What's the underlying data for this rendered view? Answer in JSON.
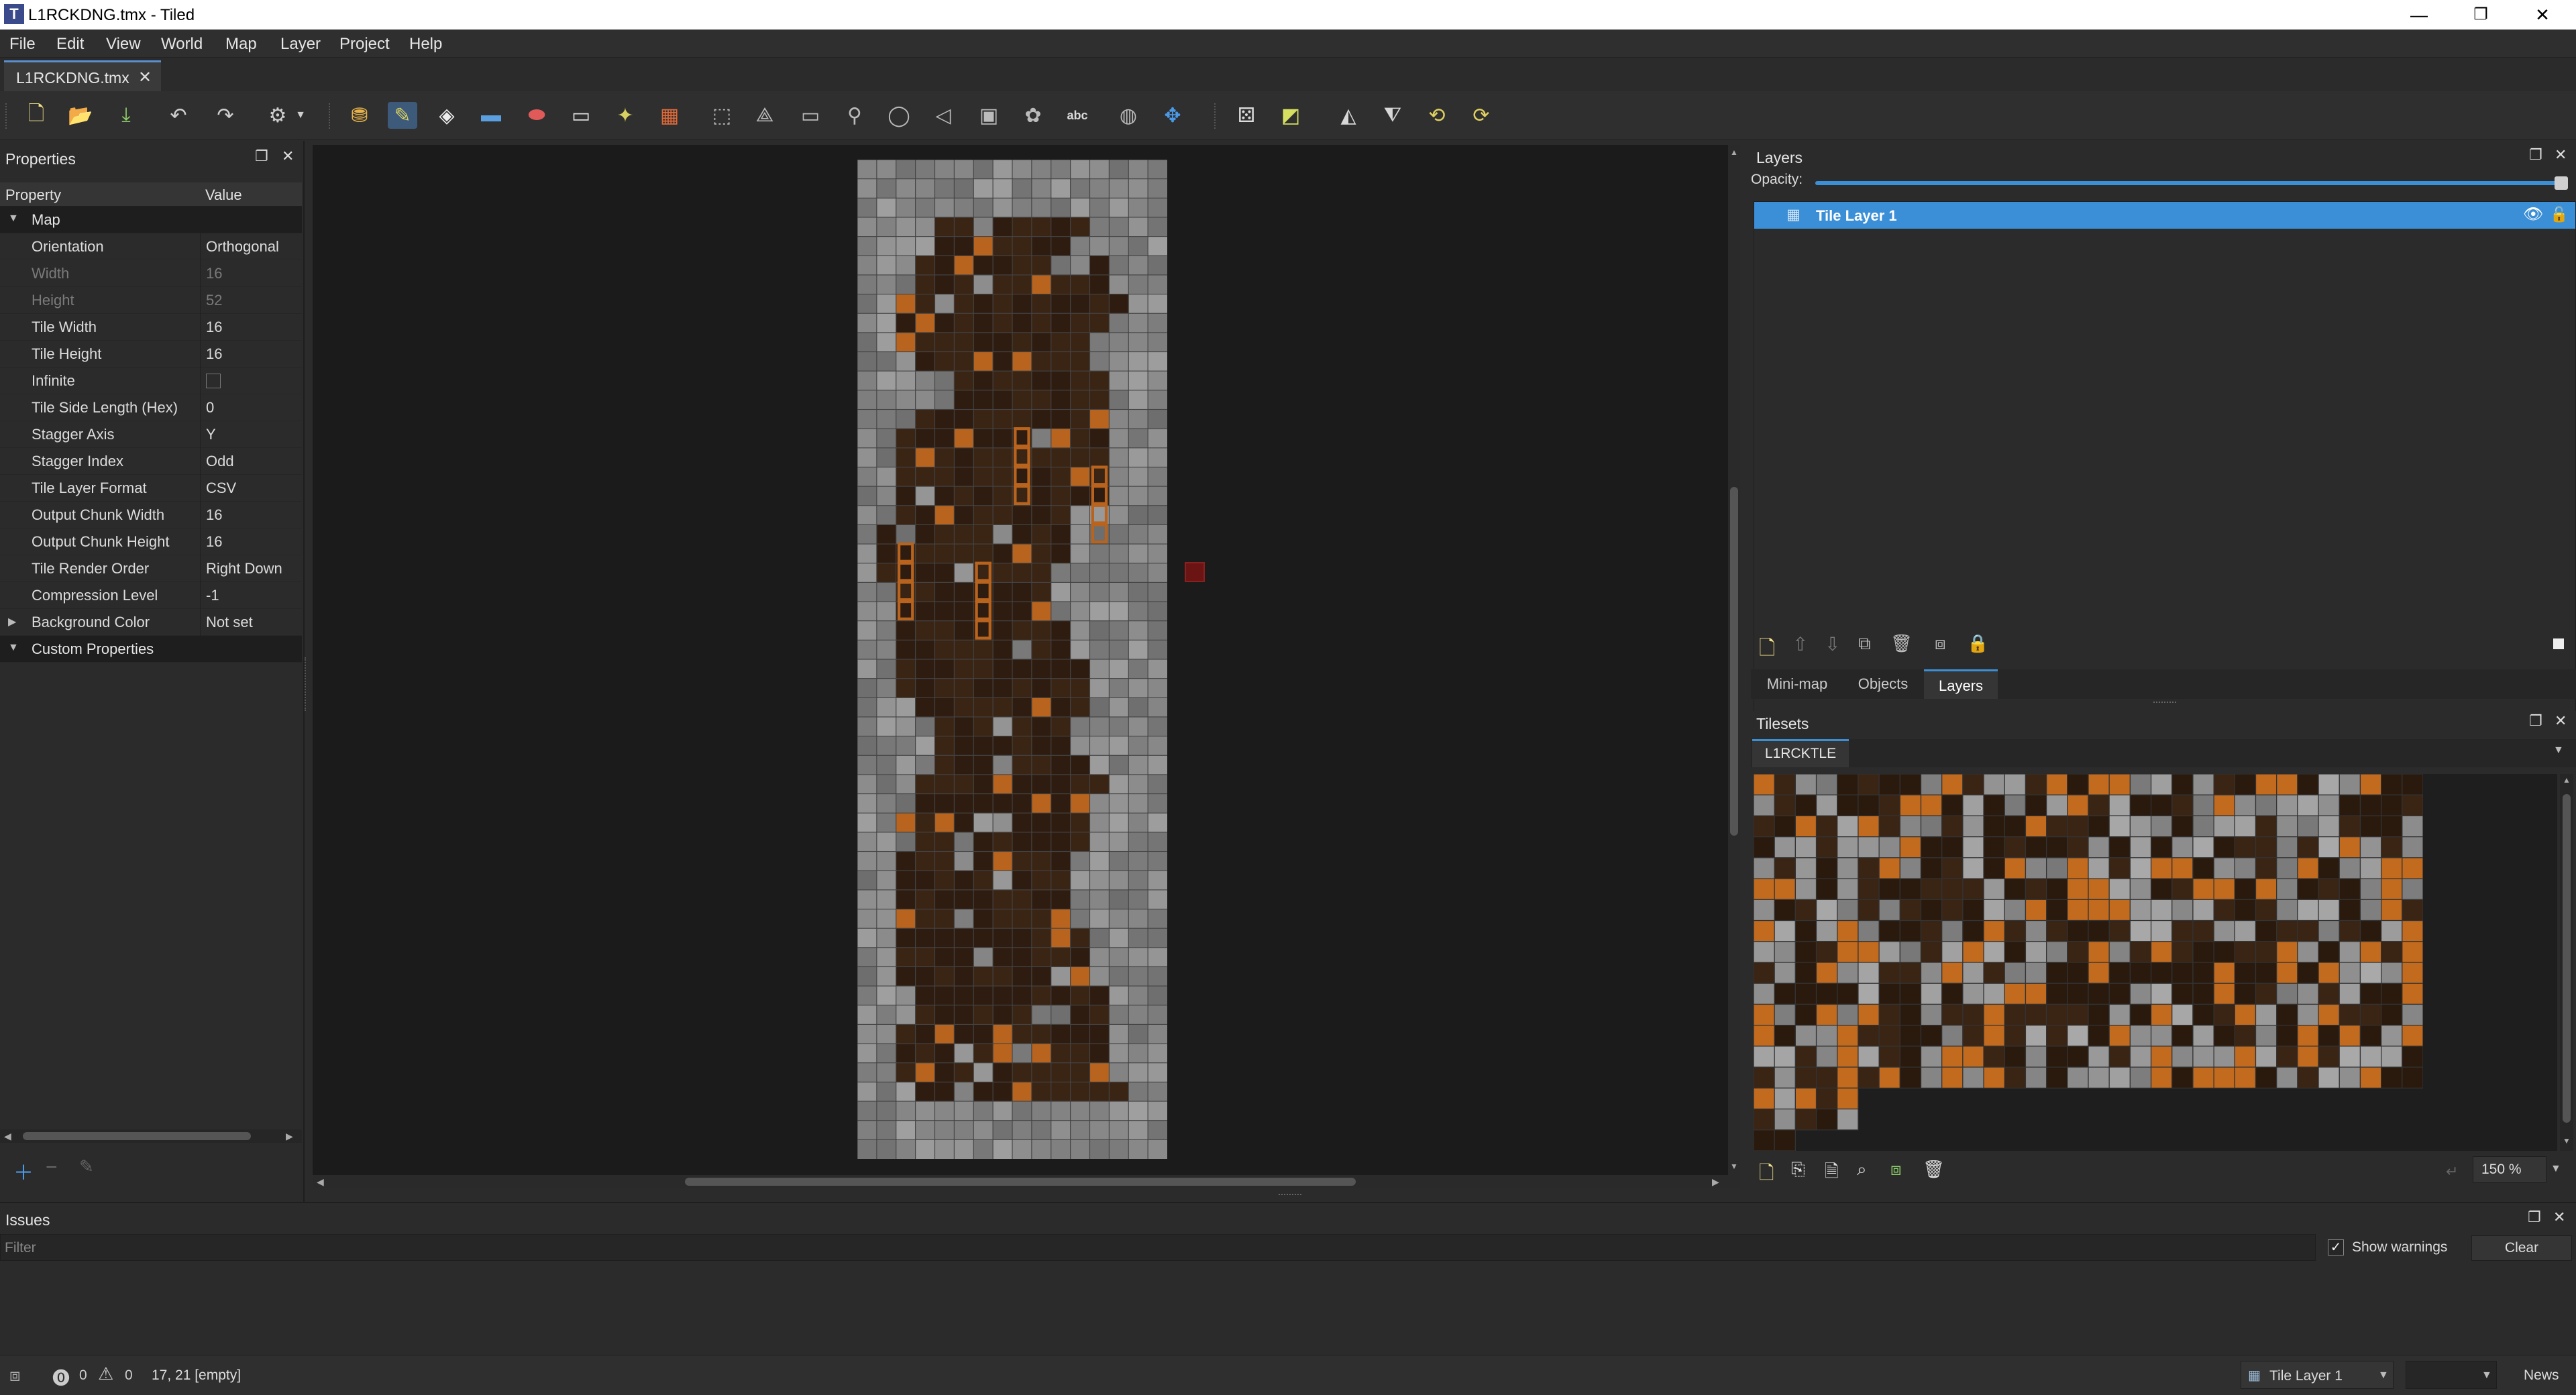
{
  "window": {
    "title": "L1RCKDNG.tmx - Tiled",
    "app_icon": "T",
    "minimize": "—",
    "maximize": "❐",
    "close": "✕"
  },
  "menu": [
    "File",
    "Edit",
    "View",
    "World",
    "Map",
    "Layer",
    "Project",
    "Help"
  ],
  "tab": {
    "label": "L1RCKDNG.tmx",
    "close": "✕"
  },
  "properties": {
    "title": "Properties",
    "col_property": "Property",
    "col_value": "Value",
    "group_map": "Map",
    "rows": [
      {
        "name": "Orientation",
        "value": "Orthogonal",
        "disabled": false
      },
      {
        "name": "Width",
        "value": "16",
        "disabled": true
      },
      {
        "name": "Height",
        "value": "52",
        "disabled": true
      },
      {
        "name": "Tile Width",
        "value": "16",
        "disabled": false
      },
      {
        "name": "Tile Height",
        "value": "16",
        "disabled": false
      },
      {
        "name": "Infinite",
        "value": "",
        "disabled": false
      },
      {
        "name": "Tile Side Length (Hex)",
        "value": "0",
        "disabled": false
      },
      {
        "name": "Stagger Axis",
        "value": "Y",
        "disabled": false
      },
      {
        "name": "Stagger Index",
        "value": "Odd",
        "disabled": false
      },
      {
        "name": "Tile Layer Format",
        "value": "CSV",
        "disabled": false
      },
      {
        "name": "Output Chunk Width",
        "value": "16",
        "disabled": false
      },
      {
        "name": "Output Chunk Height",
        "value": "16",
        "disabled": false
      },
      {
        "name": "Tile Render Order",
        "value": "Right Down",
        "disabled": false
      },
      {
        "name": "Compression Level",
        "value": "-1",
        "disabled": false
      },
      {
        "name": "Background Color",
        "value": "Not set",
        "disabled": false
      }
    ],
    "group_custom": "Custom Properties"
  },
  "layers": {
    "title": "Layers",
    "opacity_label": "Opacity:",
    "opacity": 1.0,
    "items": [
      {
        "name": "Tile Layer 1",
        "visible": true
      }
    ],
    "tabs": [
      "Mini-map",
      "Objects",
      "Layers"
    ]
  },
  "tilesets": {
    "title": "Tilesets",
    "tab": "L1RCKTLE",
    "zoom": "150 %"
  },
  "issues": {
    "title": "Issues",
    "filter_placeholder": "Filter",
    "show_warnings_label": "Show warnings",
    "show_warnings": true,
    "clear_label": "Clear"
  },
  "status": {
    "errors": "0",
    "warnings": "0",
    "cursor": "17, 21 [empty]",
    "layer_select": "Tile Layer 1",
    "news": "News"
  },
  "colors": {
    "accent": "#3b8fd6",
    "background": "#2b2b2b",
    "canvas": "#1b1b1b",
    "stone": "#8a8a8a",
    "cave": "#3a2414",
    "wood": "#b8641e"
  }
}
